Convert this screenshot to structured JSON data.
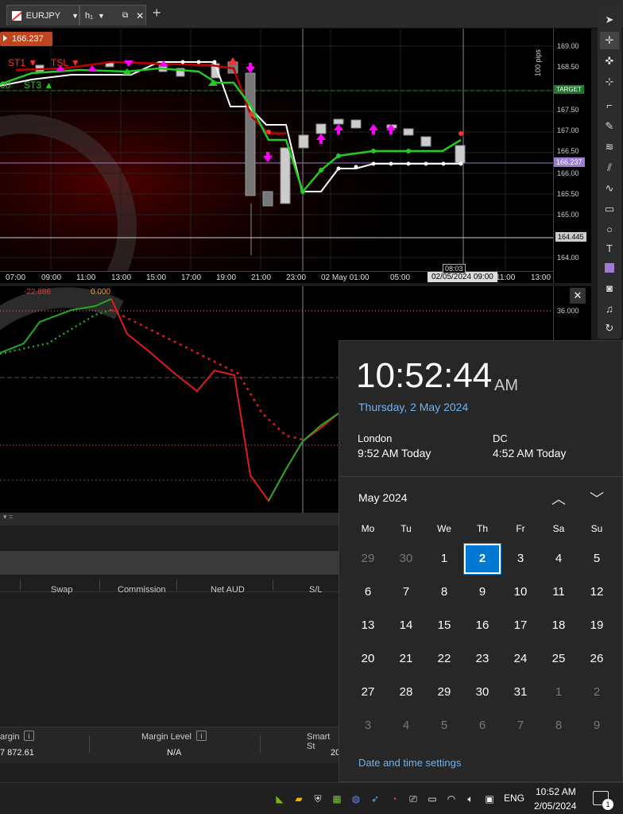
{
  "tabs": {
    "symbol": "EURJPY",
    "timeframe": "h",
    "timeframe_sub": "1",
    "add_label": "+"
  },
  "chart": {
    "price_badge": "166.237",
    "legend_st1": "ST1",
    "legend_tsl": "TSL",
    "legend_st3": "ST3",
    "legend_left": "00",
    "pips_label": "100 pips",
    "price_labels": [
      "169.00",
      "168.50",
      "167.50",
      "167.00",
      "166.50",
      "166.00",
      "165.50",
      "165.00",
      "164.00"
    ],
    "target_label": "TARGET",
    "current_price": "166.237",
    "line_price": "164.445",
    "time_labels": [
      "07:00",
      "09:00",
      "11:00",
      "13:00",
      "15:00",
      "17:00",
      "19:00",
      "21:00",
      "23:00",
      "02 May 01:00",
      "05:00",
      "11:00",
      "13:00"
    ],
    "crosshair_time": "02/05/2024 09:00",
    "countdown": "08:03"
  },
  "indicator": {
    "value1": "-22.886",
    "value2": "0.000",
    "axis_value": "36.000"
  },
  "panel": {
    "columns": [
      "Swap",
      "Commission",
      "Net AUD",
      "S/L"
    ],
    "margin_label": "argin",
    "margin_value": "7 872.61",
    "margin_level_label": "Margin Level",
    "margin_level_value": "N/A",
    "smart_label": "Smart St",
    "smart_value": "20"
  },
  "flyout": {
    "time": "10:52:44",
    "ampm": "AM",
    "date": "Thursday, 2 May 2024",
    "clocks": [
      {
        "city": "London",
        "time": "9:52 AM Today"
      },
      {
        "city": "DC",
        "time": "4:52 AM Today"
      }
    ],
    "month": "May 2024",
    "days_of_week": [
      "Mo",
      "Tu",
      "We",
      "Th",
      "Fr",
      "Sa",
      "Su"
    ],
    "weeks": [
      [
        "29",
        "30",
        "1",
        "2",
        "3",
        "4",
        "5"
      ],
      [
        "6",
        "7",
        "8",
        "9",
        "10",
        "11",
        "12"
      ],
      [
        "13",
        "14",
        "15",
        "16",
        "17",
        "18",
        "19"
      ],
      [
        "20",
        "21",
        "22",
        "23",
        "24",
        "25",
        "26"
      ],
      [
        "27",
        "28",
        "29",
        "30",
        "31",
        "1",
        "2"
      ],
      [
        "3",
        "4",
        "5",
        "6",
        "7",
        "8",
        "9"
      ]
    ],
    "settings_link": "Date and time settings"
  },
  "taskbar": {
    "lang": "ENG",
    "time": "10:52 AM",
    "date": "2/05/2024",
    "notif_count": "1"
  },
  "colors": {
    "accent": "#0078d4",
    "bull": "#22cc22",
    "bear": "#ee2222",
    "magenta": "#ff00ff"
  }
}
